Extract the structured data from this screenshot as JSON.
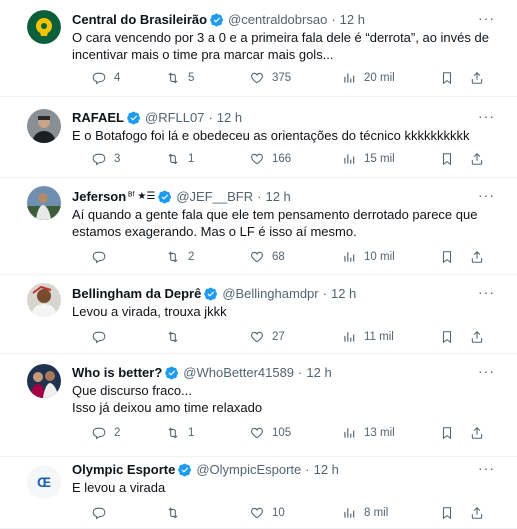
{
  "tweets": [
    {
      "name": "Central do Brasileirão",
      "handle": "@centraldobrsao",
      "time": "12 h",
      "lines": [
        "O cara vencendo por 3 a 0 e a primeira fala dele é “derrota”, ao invés de",
        "incentivar mais o time pra marcar mais gols..."
      ],
      "replies": "4",
      "retweets": "5",
      "likes": "375",
      "views": "20 mil",
      "verified": true
    },
    {
      "name": "RAFAEL",
      "handle": "@RFLL07",
      "time": "12 h",
      "lines": [
        "E o Botafogo foi lá e obedeceu as orientações do técnico kkkkkkkkkk"
      ],
      "replies": "3",
      "retweets": "1",
      "likes": "166",
      "views": "15 mil",
      "verified": true
    },
    {
      "name": "Jeferson",
      "name_suffix": "ᴮᶠ ★☰",
      "handle": "@JEF__BFR",
      "time": "12 h",
      "lines": [
        "Aí quando a gente fala que ele tem pensamento derrotado parece que",
        "estamos exagerando. Mas o LF é isso aí mesmo."
      ],
      "replies": "",
      "retweets": "2",
      "likes": "68",
      "views": "10 mil",
      "verified": true
    },
    {
      "name": "Bellingham da Deprê",
      "handle": "@Bellinghamdpr",
      "time": "12 h",
      "lines": [
        "Levou a virada, trouxa jkkk"
      ],
      "replies": "",
      "retweets": "",
      "likes": "27",
      "views": "11 mil",
      "verified": true
    },
    {
      "name": "Who is better?",
      "handle": "@WhoBetter41589",
      "time": "12 h",
      "lines": [
        "Que discurso fraco...",
        "Isso já  deixou amo time relaxado"
      ],
      "replies": "2",
      "retweets": "1",
      "likes": "105",
      "views": "13 mil",
      "verified": true
    },
    {
      "name": "Olympic Esporte",
      "handle": "@OlympicEsporte",
      "time": "12 h",
      "lines": [
        "E levou a virada"
      ],
      "replies": "",
      "retweets": "",
      "likes": "10",
      "views": "8 mil",
      "verified": true
    }
  ],
  "colors": {
    "verified": "#1d9bf0",
    "text": "#0f1419",
    "muted": "#536471",
    "divider": "#eff3f4"
  },
  "icons": {
    "reply": "reply-icon",
    "retweet": "retweet-icon",
    "like": "heart-icon",
    "views": "views-icon",
    "bookmark": "bookmark-icon",
    "share": "share-icon",
    "more": "more-icon",
    "verified": "verified-badge-icon"
  }
}
